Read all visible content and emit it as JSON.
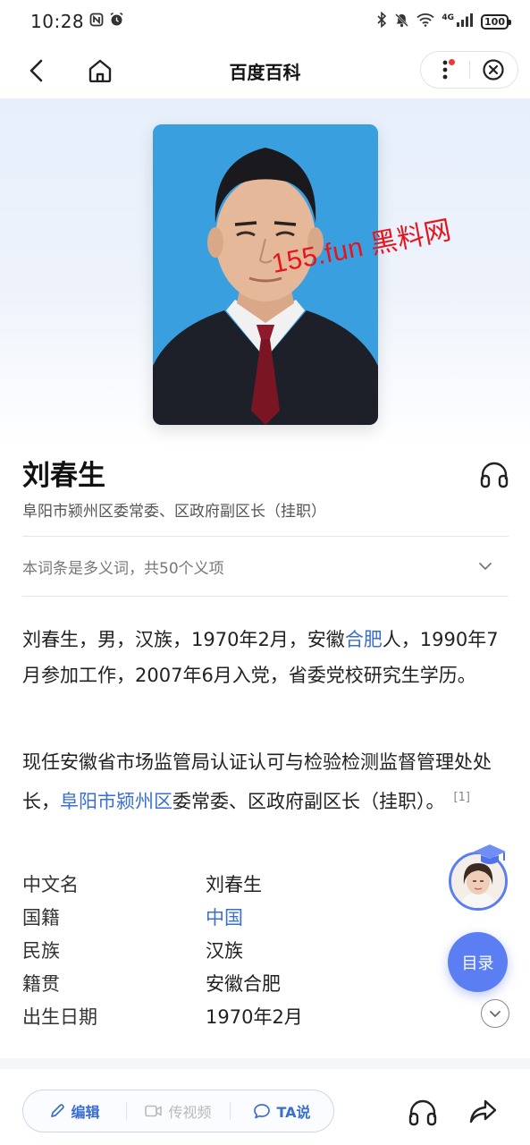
{
  "status_bar": {
    "time": "10:28",
    "network": "4G",
    "battery": "100",
    "icons": [
      "nfc-icon",
      "alarm-icon",
      "bluetooth-icon",
      "mute-icon",
      "wifi-icon",
      "signal-icon",
      "battery-icon"
    ]
  },
  "nav": {
    "title": "百度百科",
    "icons": [
      "back-icon",
      "home-icon",
      "more-icon",
      "close-circle-icon"
    ]
  },
  "hero": {
    "watermark": "155.fun 黑料网",
    "photo_background": "#3a9fdf"
  },
  "entry": {
    "name": "刘春生",
    "subtitle": "阜阳市颍州区委常委、区政府副区长（挂职）",
    "polysemy_note": "本词条是多义词，共50个义项"
  },
  "summary": {
    "p1_before": "刘春生，男，汉族，1970年2月，安徽",
    "p1_link": "合肥",
    "p1_after": "人，1990年7月参加工作，2007年6月入党，省委党校研究生学历。",
    "p2_before": "现任安徽省市场监管局认证认可与检验检测监督管理处处长，",
    "p2_link": "阜阳市颍州区",
    "p2_after": "委常委、区政府副区长（挂职）。",
    "citation": "[1]"
  },
  "info": [
    {
      "label": "中文名",
      "value": "刘春生",
      "is_link": false
    },
    {
      "label": "国籍",
      "value": "中国",
      "is_link": true
    },
    {
      "label": "民族",
      "value": "汉族",
      "is_link": false
    },
    {
      "label": "籍贯",
      "value": "安徽合肥",
      "is_link": false
    },
    {
      "label": "出生日期",
      "value": "1970年2月",
      "is_link": false
    }
  ],
  "floating": {
    "toc_label": "目录"
  },
  "bottom_bar": {
    "edit_label": "编辑",
    "video_label": "传视频",
    "ta_label": "TA说"
  },
  "colors": {
    "accent": "#3b6ed1",
    "toc_button": "#5b7ff2",
    "watermark": "#e8141d",
    "link": "#3b6ed1"
  }
}
